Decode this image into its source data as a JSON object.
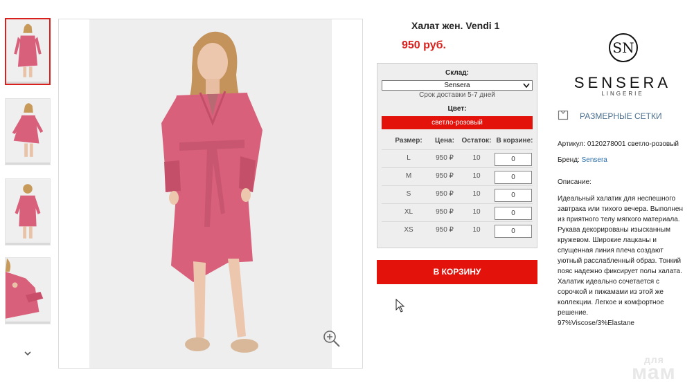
{
  "product": {
    "title": "Халат жен. Vendi 1",
    "price": "950 руб."
  },
  "stock": {
    "warehouse_label": "Склад:",
    "warehouse_value": "Sensera",
    "delivery": "Срок доставки 5-7 дней",
    "color_label": "Цвет:",
    "color_value": "светло-розовый",
    "headers": {
      "size": "Размер:",
      "price": "Цена:",
      "stock": "Остаток:",
      "cart": "В корзине:"
    },
    "rows": [
      {
        "size": "L",
        "price": "950 ₽",
        "stock": "10",
        "qty": "0"
      },
      {
        "size": "M",
        "price": "950 ₽",
        "stock": "10",
        "qty": "0"
      },
      {
        "size": "S",
        "price": "950 ₽",
        "stock": "10",
        "qty": "0"
      },
      {
        "size": "XL",
        "price": "950 ₽",
        "stock": "10",
        "qty": "0"
      },
      {
        "size": "XS",
        "price": "950 ₽",
        "stock": "10",
        "qty": "0"
      }
    ]
  },
  "cart_button": "В КОРЗИНУ",
  "brand": {
    "name": "SENSERA",
    "sub": "LINGERIE",
    "mark_letters": "SN"
  },
  "size_charts": "РАЗМЕРНЫЕ СЕТКИ",
  "details": {
    "article_label": "Артикул:",
    "article_value": "0120278001 светло-розовый",
    "brand_label": "Бренд:",
    "brand_value": "Sensera",
    "description_label": "Описание:",
    "description_lines": [
      "Идеальный халатик для неспешного",
      "завтрака или тихого вечера. Выполнен",
      "из приятного телу мягкого материала.",
      "Рукава декорированы изысканным",
      "кружевом. Широкие лацканы и",
      "спущенная линия плеча создают",
      "уютный расслабленный образ. Тонкий",
      "пояс надежно фиксирует полы халата.",
      "Халатик идеально сочетается с",
      "сорочкой и пижамами из этой же",
      "коллекции. Легкое и комфортное",
      "решение.",
      "97%Viscose/3%Elastane"
    ]
  },
  "watermark": {
    "top": "для",
    "bottom": "мам"
  },
  "colors": {
    "accent_red": "#e3120b",
    "price_red": "#d9201c",
    "robe_pink": "#d9607a",
    "link_blue": "#2a6ca8"
  },
  "icons": [
    "chevron-down-icon",
    "zoom-in-icon",
    "hanger-icon",
    "mouse-cursor-icon"
  ]
}
